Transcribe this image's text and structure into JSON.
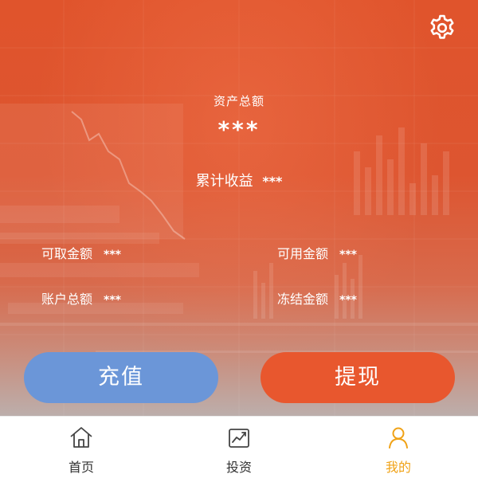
{
  "colors": {
    "hero_top": "#e0542c",
    "recharge_button": "#6b96d8",
    "withdraw_button": "#e8572e",
    "active_tab": "#f0a216",
    "inactive_tab": "#333333"
  },
  "header": {
    "settings_icon": "gear-icon"
  },
  "summary": {
    "total_assets_label": "资产总额",
    "total_assets_value": "***",
    "accumulated_profit_label": "累计收益",
    "accumulated_profit_value": "***"
  },
  "stats": {
    "withdrawable": {
      "label": "可取金额",
      "value": "***"
    },
    "available": {
      "label": "可用金额",
      "value": "***"
    },
    "account_total": {
      "label": "账户总额",
      "value": "***"
    },
    "frozen": {
      "label": "冻结金额",
      "value": "***"
    }
  },
  "actions": {
    "recharge_label": "充值",
    "withdraw_label": "提现"
  },
  "tabbar": {
    "active": "mine",
    "items": [
      {
        "id": "home",
        "label": "首页",
        "icon": "home-icon"
      },
      {
        "id": "invest",
        "label": "投资",
        "icon": "chart-icon"
      },
      {
        "id": "mine",
        "label": "我的",
        "icon": "user-icon"
      }
    ]
  }
}
